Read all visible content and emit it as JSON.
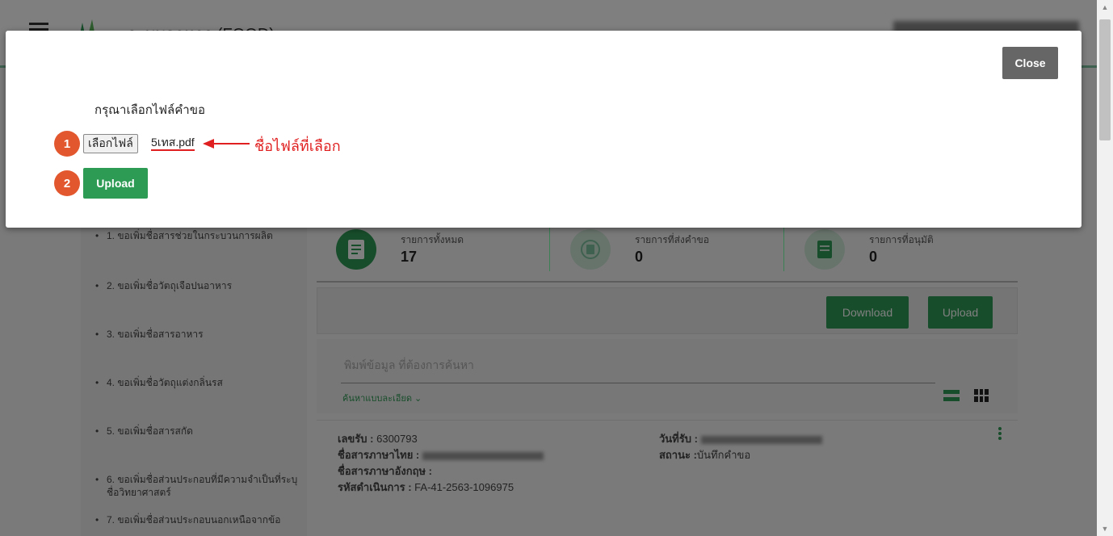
{
  "app": {
    "brand": "ระบบอาหาร (FOOD)"
  },
  "sidebar": {
    "items": [
      {
        "label": "1. ขอเพิ่มชื่อสารช่วยในกระบวนการผลิต"
      },
      {
        "label": "2. ขอเพิ่มชื่อวัตถุเจือปนอาหาร"
      },
      {
        "label": "3. ขอเพิ่มชื่อสารอาหาร"
      },
      {
        "label": "4. ขอเพิ่มชื่อวัตถุแต่งกลิ่นรส"
      },
      {
        "label": "5. ขอเพิ่มชื่อสารสกัด"
      },
      {
        "label": "6. ขอเพิ่มชื่อส่วนประกอบที่มีความจำเป็นที่ระบุชื่อวิทยาศาสตร์"
      },
      {
        "label": "7. ขอเพิ่มชื่อส่วนประกอบนอกเหนือจากข้อ"
      }
    ]
  },
  "stats": [
    {
      "label": "รายการทั้งหมด",
      "value": "17",
      "color": "#2e9b55"
    },
    {
      "label": "รายการที่ส่งคำขอ",
      "value": "0",
      "color": "#7fc3a0"
    },
    {
      "label": "รายการที่อนุมัติ",
      "value": "0",
      "color": "#2e9b55"
    }
  ],
  "toolbar": {
    "download_label": "Download",
    "upload_label": "Upload"
  },
  "search": {
    "placeholder": "พิมพ์ข้อมูล ที่ต้องการค้นหา",
    "advanced_label": "ค้นหาแบบละเอียด ⌄"
  },
  "records": [
    {
      "receipt_label": "เลขรับ :",
      "receipt_no": "6300793",
      "thai_name_label": "ชื่อสารภาษาไทย :",
      "eng_name_label": "ชื่อสารภาษาอังกฤษ :",
      "process_code_label": "รหัสดำเนินการ :",
      "process_code": "FA-41-2563-1096975",
      "date_label": "วันที่รับ :",
      "status_label": "สถานะ :",
      "status": "บันทึกคำขอ"
    }
  ],
  "modal": {
    "close_label": "Close",
    "title": "กรุณาเลือกไฟล์คำขอ",
    "step1": "1",
    "step2": "2",
    "choose_file_label": "เลือกไฟล์",
    "file_name": "5เทส.pdf",
    "annotation": "ชื่อไฟล์ที่เลือก",
    "upload_label": "Upload",
    "accent_color": "#e3572e",
    "annotation_color": "#e02020"
  }
}
